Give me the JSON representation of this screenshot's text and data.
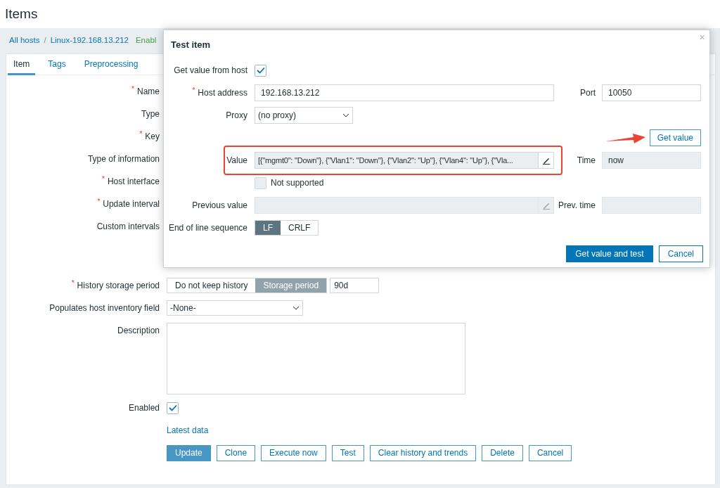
{
  "page_title": "Items",
  "breadcrumb": [
    {
      "label": "All hosts",
      "kind": "link"
    },
    {
      "label": "/",
      "kind": "separator"
    },
    {
      "label": "Linux-192.168.13.212",
      "kind": "link"
    },
    {
      "label": "Enabl",
      "kind": "status"
    }
  ],
  "tabs": [
    {
      "label": "Item",
      "selected": true
    },
    {
      "label": "Tags",
      "selected": false
    },
    {
      "label": "Preprocessing",
      "selected": false
    }
  ],
  "form_labels": [
    {
      "label": "Name",
      "required_marker": "*"
    },
    {
      "label": "Type"
    },
    {
      "label": "Key",
      "required_marker": "*"
    },
    {
      "label": "Type of information"
    },
    {
      "label": "Host interface",
      "required_marker": "*"
    },
    {
      "label": "Update interval",
      "required_marker": "*"
    },
    {
      "label": "Custom intervals"
    }
  ],
  "history_storage": {
    "label": "History storage period",
    "required_marker": "*",
    "options": [
      {
        "label": "Do not keep history",
        "selected": false
      },
      {
        "label": "Storage period",
        "selected": true
      }
    ],
    "value": "90d"
  },
  "inventory_field": {
    "label": "Populates host inventory field",
    "value": "-None-"
  },
  "description": {
    "label": "Description"
  },
  "enabled": {
    "label": "Enabled",
    "checked": true
  },
  "latest_data_link": "Latest data",
  "buttons": [
    {
      "label": "Update",
      "primary": true
    },
    {
      "label": "Clone",
      "primary": false
    },
    {
      "label": "Execute now",
      "primary": false
    },
    {
      "label": "Test",
      "primary": false
    },
    {
      "label": "Clear history and trends",
      "primary": false
    },
    {
      "label": "Delete",
      "primary": false
    },
    {
      "label": "Cancel",
      "primary": false
    }
  ],
  "dialog": {
    "title": "Test item",
    "close": "×",
    "get_value_from_host": {
      "label": "Get value from host",
      "checked": true
    },
    "host_address": {
      "label": "Host address",
      "required_marker": "*",
      "value": "192.168.13.212"
    },
    "port": {
      "label": "Port",
      "value": "10050"
    },
    "proxy": {
      "label": "Proxy",
      "value": "(no proxy)"
    },
    "get_value_button": "Get value",
    "value": {
      "label": "Value",
      "value": "[{\"mgmt0\": \"Down\"}, {\"Vlan1\": \"Down\"}, {\"Vlan2\": \"Up\"}, {\"Vlan4\": \"Up\"}, {\"Vla..."
    },
    "time": {
      "label": "Time",
      "value": "now"
    },
    "not_supported": {
      "label": "Not supported",
      "checked": false
    },
    "previous_value": {
      "label": "Previous value"
    },
    "prev_time": {
      "label": "Prev. time"
    },
    "eol": {
      "label": "End of line sequence",
      "options": [
        {
          "label": "LF",
          "selected": true
        },
        {
          "label": "CRLF",
          "selected": false
        }
      ]
    },
    "buttons": [
      {
        "label": "Get value and test",
        "primary": true
      },
      {
        "label": "Cancel",
        "primary": false
      }
    ]
  }
}
